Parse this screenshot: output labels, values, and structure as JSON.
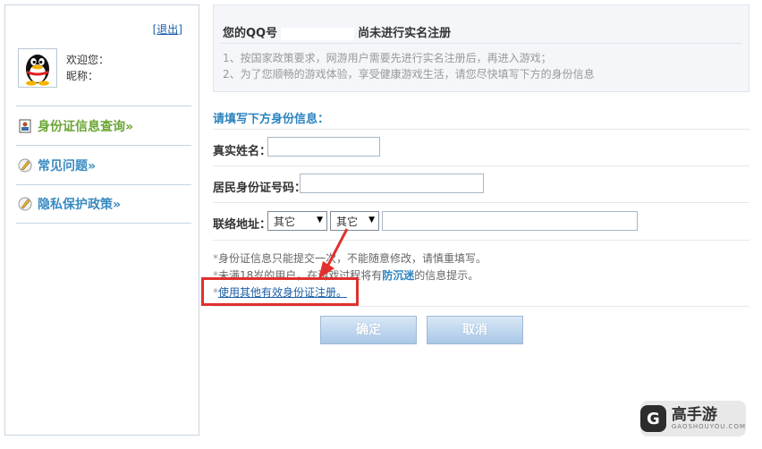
{
  "sidebar": {
    "logout_label": "[退出]",
    "welcome_label": "欢迎您：",
    "nickname_label": "昵称：",
    "menu": [
      {
        "label": "身份证信息查询»",
        "icon": "id-card-icon"
      },
      {
        "label": "常见问题»",
        "icon": "pencil-icon"
      },
      {
        "label": "隐私保护政策»",
        "icon": "pencil-icon"
      }
    ]
  },
  "notice": {
    "title_prefix": "您的QQ号",
    "title_suffix": "尚未进行实名注册",
    "lines": [
      "1、按国家政策要求，网游用户需要先进行实名注册后，再进入游戏；",
      "2、为了您顺畅的游戏体验，享受健康游戏生活，请您尽快填写下方的身份信息"
    ]
  },
  "form": {
    "section_title": "请填写下方身份信息：",
    "name_label": "真实姓名：",
    "id_label": "居民身份证号码：",
    "address_label": "联络地址：",
    "province_selected": "其它",
    "city_selected": "其它"
  },
  "hints": {
    "line1": "身份证信息只能提交一次，不能随意修改，请慎重填写。",
    "line2_pre": "未满18岁的用户，在游戏过程将有",
    "line2_strong": "防沉迷",
    "line2_post": "的信息提示。",
    "link": "使用其他有效身份证注册。"
  },
  "buttons": {
    "confirm": "确定",
    "cancel": "取消"
  },
  "watermark": {
    "logo_letter": "G",
    "brand": "高手游",
    "domain": "GAOSHOUYOU.COM"
  },
  "colors": {
    "accent_blue": "#2a83bf",
    "highlight_red": "#e0302e",
    "menu_green": "#6aa433"
  }
}
